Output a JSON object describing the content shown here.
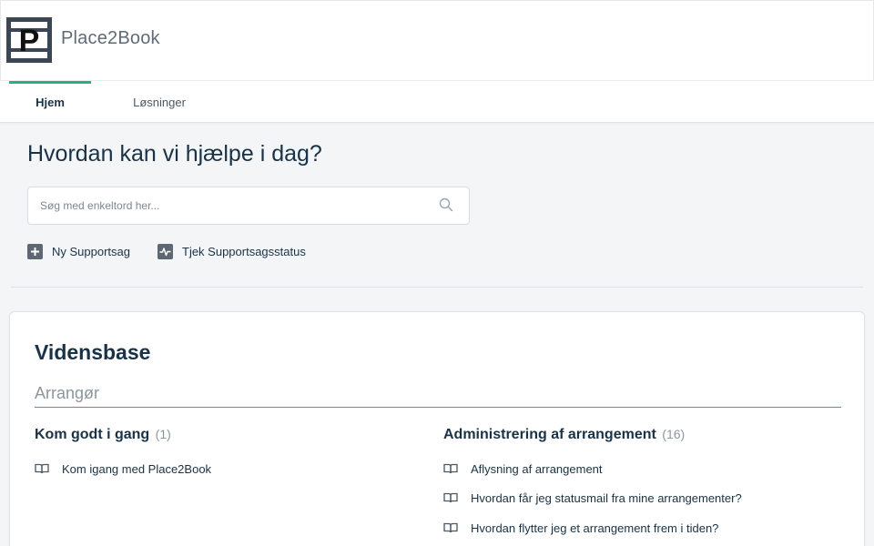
{
  "brand": {
    "name": "Place2Book",
    "logo_letter": "P"
  },
  "nav": {
    "tabs": [
      {
        "label": "Hjem"
      },
      {
        "label": "Løsninger"
      }
    ]
  },
  "hero": {
    "title": "Hvordan kan vi hjælpe i dag?",
    "search_placeholder": "Søg med enkeltord her...",
    "quick_links": [
      {
        "label": "Ny Supportsag",
        "icon": "plus-square-icon"
      },
      {
        "label": "Tjek Supportsagsstatus",
        "icon": "activity-icon"
      }
    ]
  },
  "knowledge_base": {
    "title": "Vidensbase",
    "category": "Arrangør",
    "folders": [
      {
        "title": "Kom godt i gang",
        "count": "(1)",
        "articles": [
          "Kom igang med Place2Book"
        ]
      },
      {
        "title": "Administrering af arrangement",
        "count": "(16)",
        "articles": [
          "Aflysning af arrangement",
          "Hvordan får jeg statusmail fra mine arrangementer?",
          "Hvordan flytter jeg et arrangement frem i tiden?"
        ]
      }
    ]
  },
  "colors": {
    "accent": "#27b17d",
    "text": "#183247",
    "background": "#f3f5f7",
    "logo_bg": "#3a4654"
  }
}
